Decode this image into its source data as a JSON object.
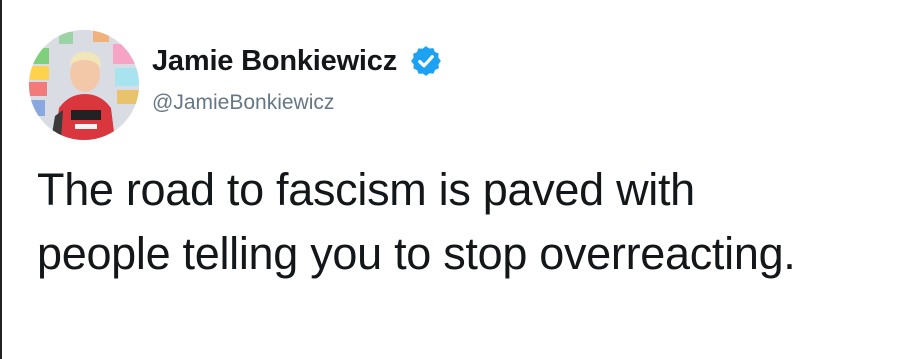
{
  "author": {
    "display_name": "Jamie Bonkiewicz",
    "handle": "@JamieBonkiewicz",
    "verified": true,
    "avatar_icon": "profile-photo"
  },
  "tweet": {
    "lines": [
      "The road to fascism is paved with",
      "people telling you to stop overreacting."
    ]
  },
  "colors": {
    "verified_badge": "#1da1f2",
    "handle": "#657786",
    "text": "#14171a"
  }
}
